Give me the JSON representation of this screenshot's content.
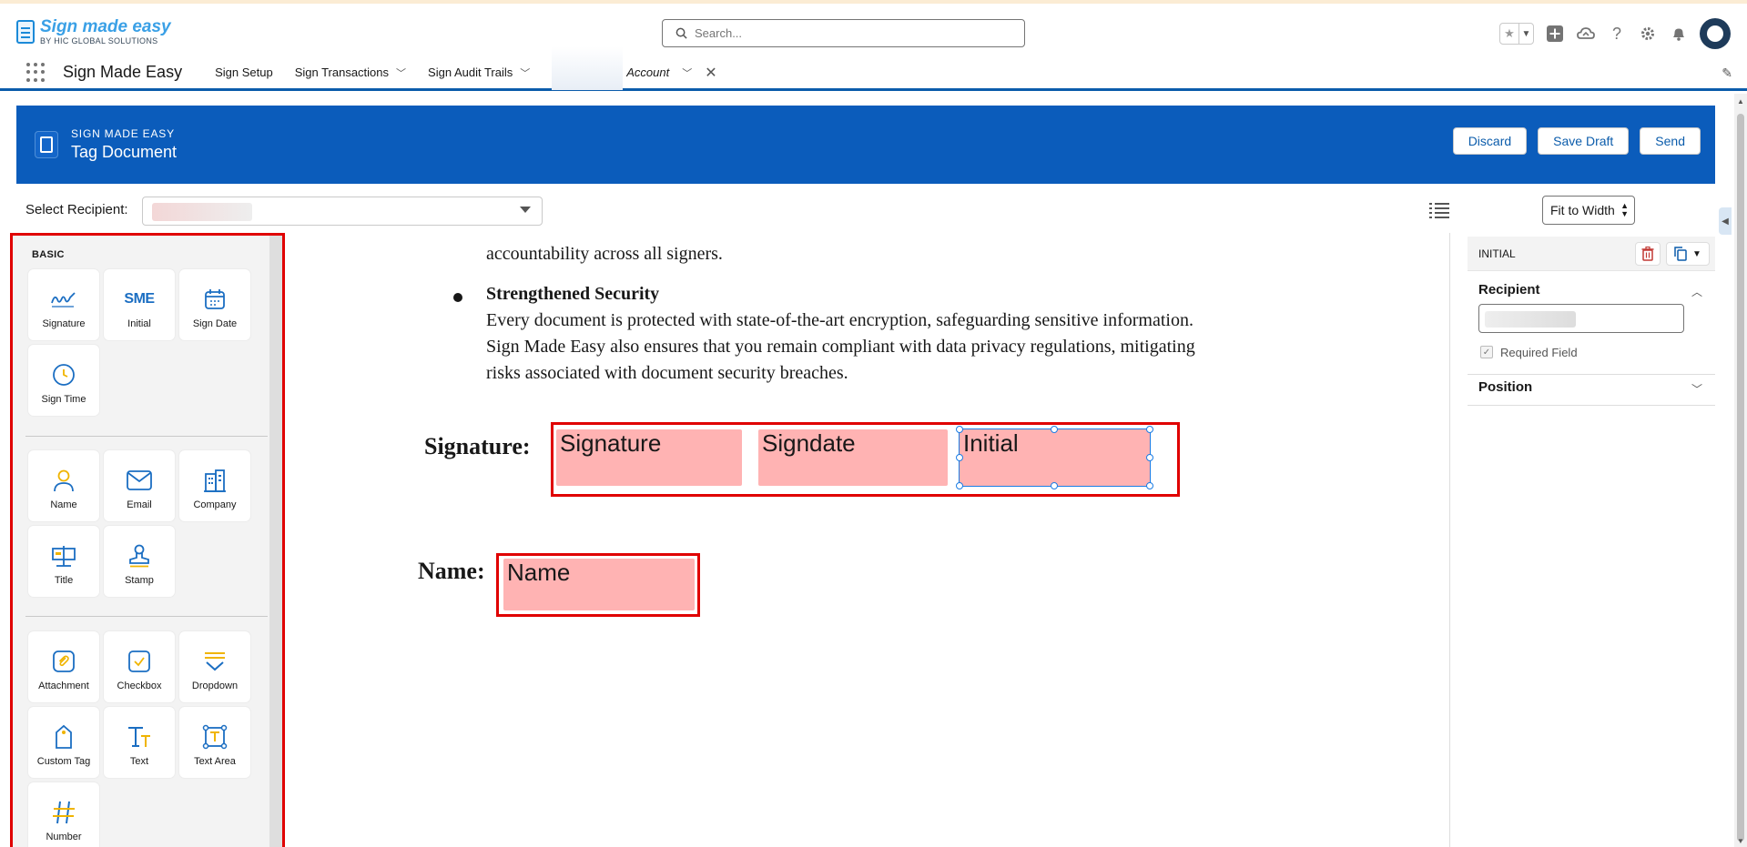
{
  "header": {
    "logo_main": "Sign made easy",
    "logo_sub": "BY HIC GLOBAL SOLUTIONS",
    "search_placeholder": "Search..."
  },
  "nav": {
    "app_name": "Sign Made Easy",
    "items": [
      {
        "label": "Sign Setup",
        "has_menu": false
      },
      {
        "label": "Sign Transactions",
        "has_menu": true
      },
      {
        "label": "Sign Audit Trails",
        "has_menu": true
      }
    ],
    "active_tab": "Account"
  },
  "banner": {
    "eyebrow": "SIGN MADE EASY",
    "title": "Tag Document",
    "buttons": {
      "discard": "Discard",
      "save_draft": "Save Draft",
      "send": "Send"
    }
  },
  "toolbar": {
    "recipient_label": "Select Recipient:",
    "fit_option": "Fit to Width"
  },
  "palette": {
    "section_title": "BASIC",
    "tiles": {
      "signature": "Signature",
      "initial": "Initial",
      "sign_date": "Sign Date",
      "sign_time": "Sign Time",
      "name": "Name",
      "email": "Email",
      "company": "Company",
      "title": "Title",
      "stamp": "Stamp",
      "attachment": "Attachment",
      "checkbox": "Checkbox",
      "dropdown": "Dropdown",
      "custom_tag": "Custom Tag",
      "text": "Text",
      "text_area": "Text Area",
      "number": "Number"
    },
    "initial_icon_text": "SME"
  },
  "document": {
    "line_partial": "accountability across all signers.",
    "bullet_heading": "Strengthened Security",
    "para_lines": [
      "Every document is protected with state-of-the-art encryption, safeguarding sensitive information.",
      "Sign Made Easy also ensures that you remain compliant with data privacy regulations, mitigating",
      "risks associated with document security breaches."
    ],
    "signature_label": "Signature:",
    "name_label": "Name:",
    "tags": {
      "signature": "Signature",
      "signdate": "Signdate",
      "initial": "Initial",
      "name": "Name"
    }
  },
  "properties": {
    "title": "INITIAL",
    "recipient_section": "Recipient",
    "required_label": "Required Field",
    "required_checked": true,
    "position_section": "Position"
  },
  "colors": {
    "brand_blue": "#0b5cbb",
    "tag_fill": "#ffb3b3",
    "highlight_red": "#e00000",
    "selection_blue": "#1b7ce4"
  }
}
